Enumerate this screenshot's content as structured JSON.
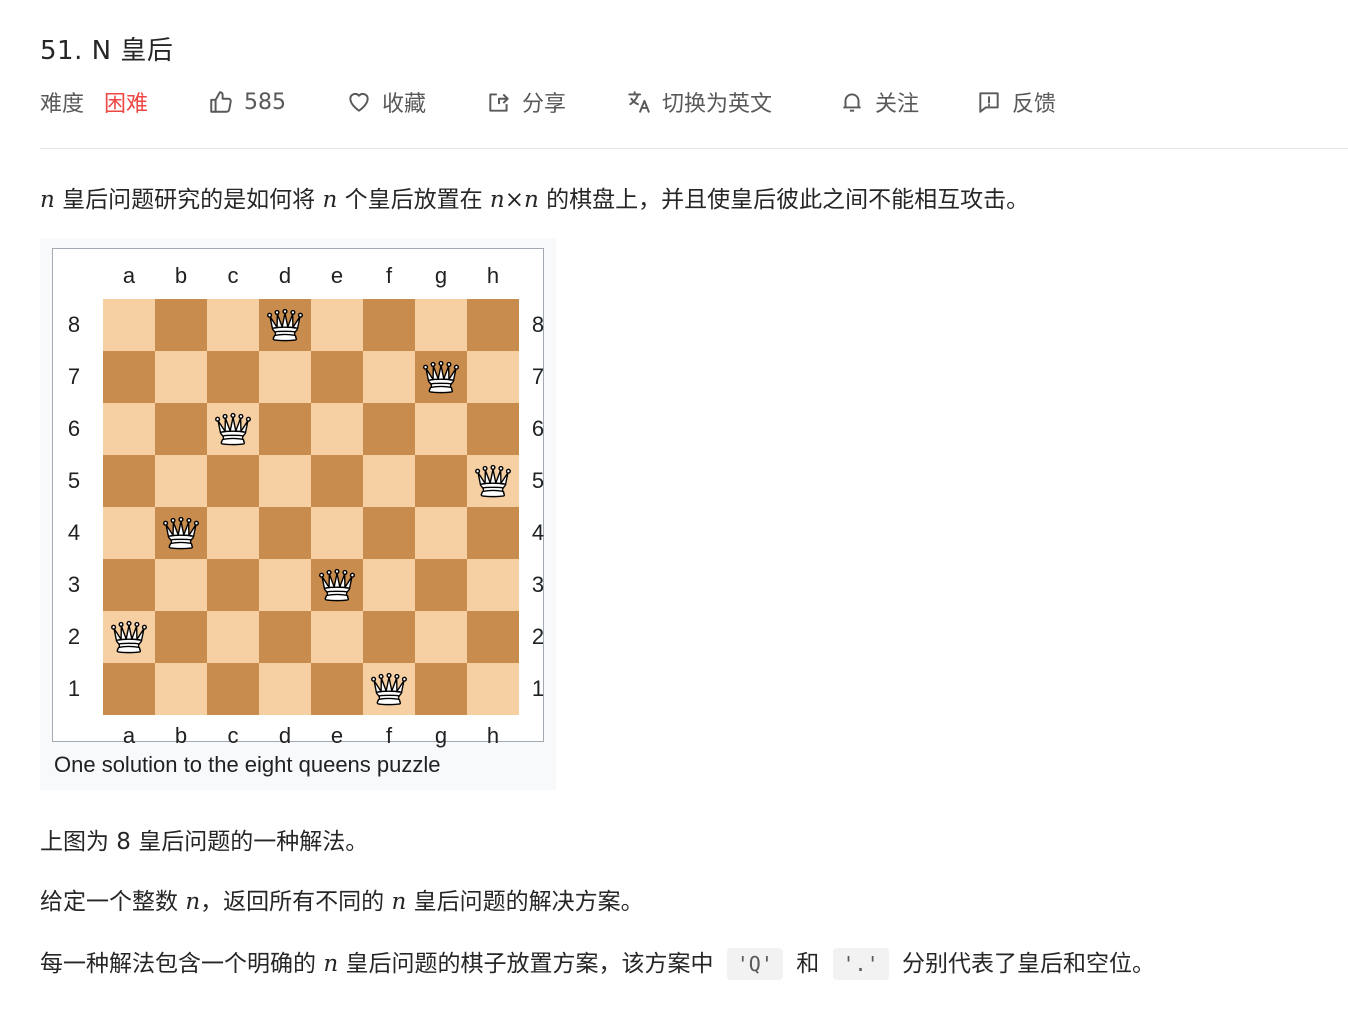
{
  "problem": {
    "title": "51. N 皇后",
    "difficulty_label": "难度",
    "difficulty_value": "困难",
    "likes": "585",
    "favorite": "收藏",
    "share": "分享",
    "switch_lang": "切换为英文",
    "follow": "关注",
    "feedback": "反馈"
  },
  "description": {
    "p1_a": "n",
    "p1_b": " 皇后问题研究的是如何将 ",
    "p1_c": "n",
    "p1_d": " 个皇后放置在 ",
    "p1_e": "n×n",
    "p1_f": " 的棋盘上，并且使皇后彼此之间不能相互攻击。",
    "p2": "上图为 8 皇后问题的一种解法。",
    "p3_a": "给定一个整数 ",
    "p3_b": "n",
    "p3_c": "，返回所有不同的 ",
    "p3_d": "n",
    "p3_e": " 皇后问题的解决方案。",
    "p4_a": "每一种解法包含一个明确的 ",
    "p4_b": "n",
    "p4_c": " 皇后问题的棋子放置方案，该方案中 ",
    "p4_code1": "'Q'",
    "p4_d": " 和 ",
    "p4_code2": "'.'",
    "p4_e": " 分别代表了皇后和空位。"
  },
  "figure": {
    "files": [
      "a",
      "b",
      "c",
      "d",
      "e",
      "f",
      "g",
      "h"
    ],
    "ranks": [
      "8",
      "7",
      "6",
      "5",
      "4",
      "3",
      "2",
      "1"
    ],
    "queens": [
      "d8",
      "g7",
      "c6",
      "h5",
      "b4",
      "e3",
      "a2",
      "f1"
    ],
    "caption": "One solution to the eight queens puzzle",
    "light_color": "#f6d0a2",
    "dark_color": "#c88c4f"
  }
}
